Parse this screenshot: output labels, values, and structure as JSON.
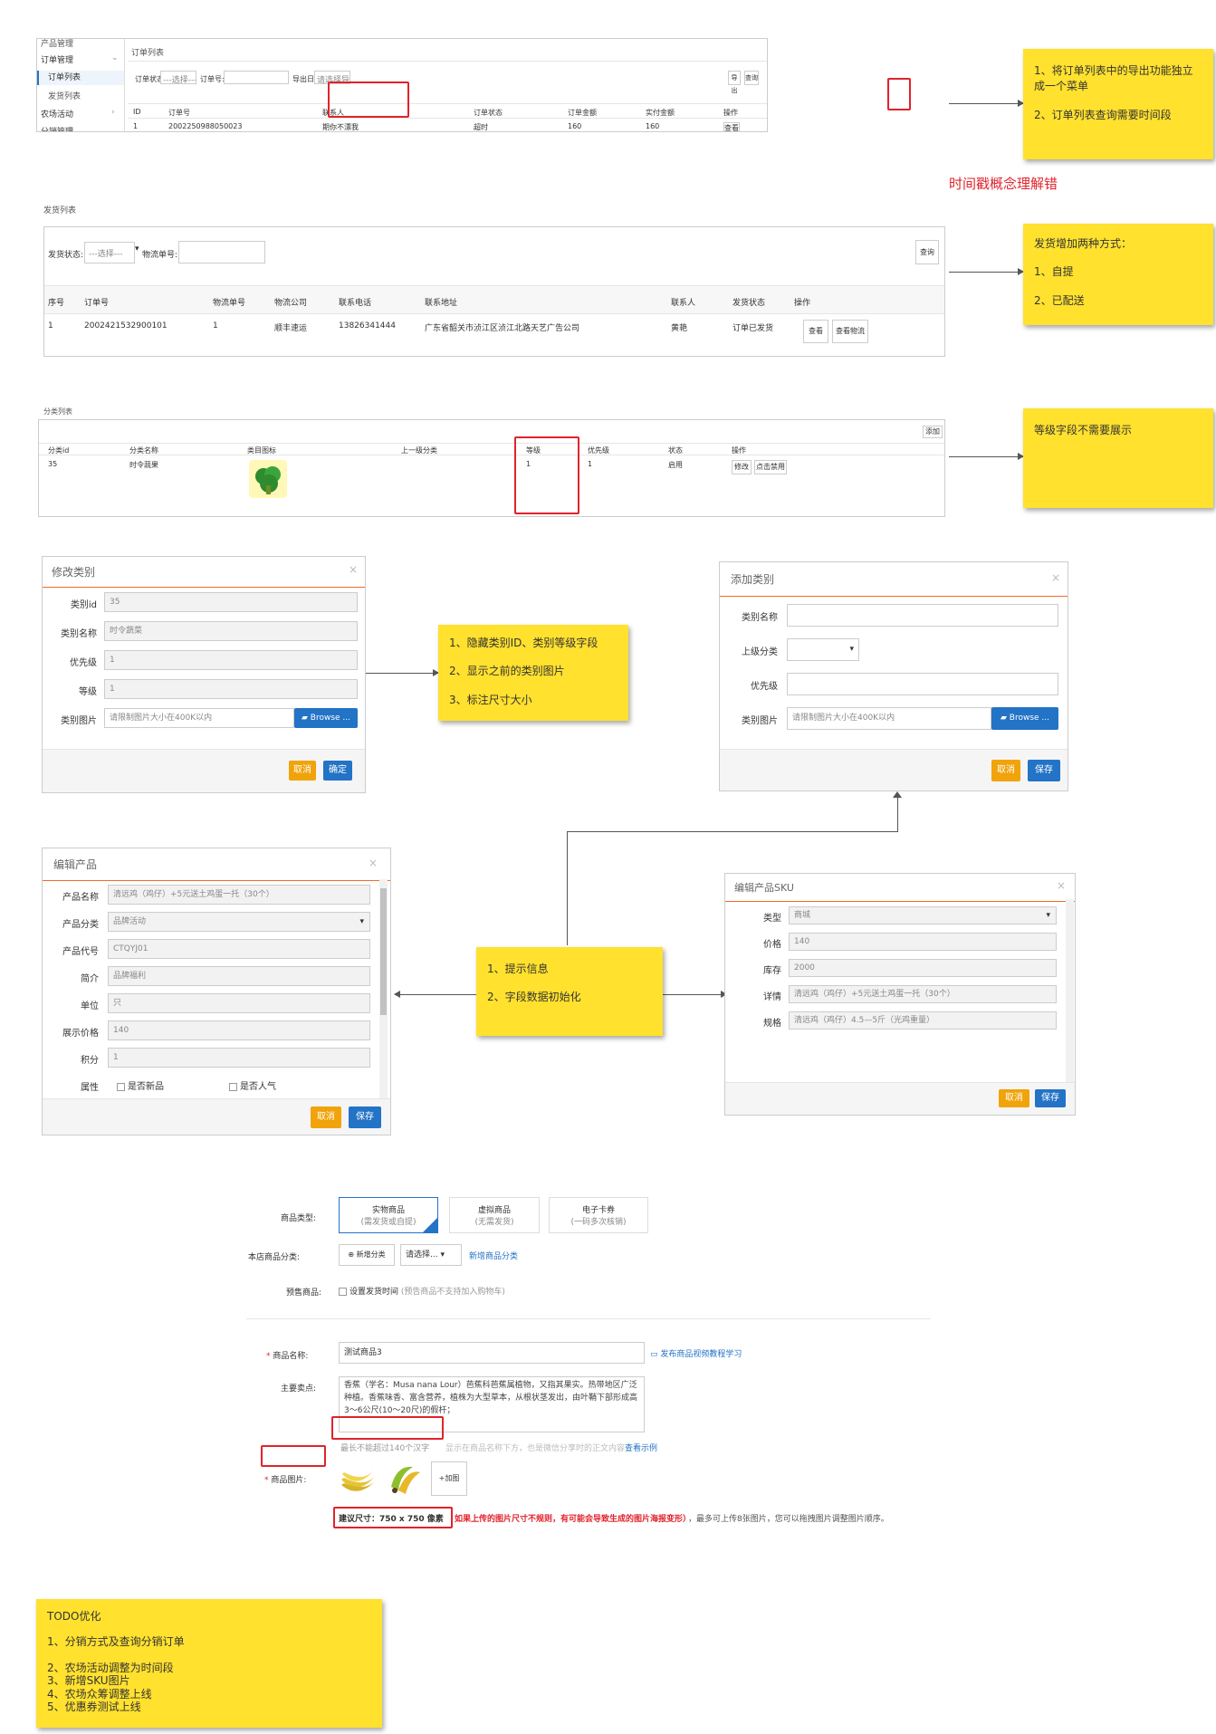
{
  "order_list": {
    "sidebar": [
      "产品管理",
      "订单管理",
      "订单列表",
      "发货列表",
      "农场活动",
      "分销管理"
    ],
    "title": "订单列表",
    "filter_status_label": "订单状态:",
    "filter_status_value": "---选择---",
    "filter_order_label": "订单号:",
    "filter_export_label": "导出日期:",
    "filter_export_value": "请选择导出日",
    "export_btn": "导出",
    "query_btn": "查询",
    "columns": [
      "ID",
      "订单号",
      "联系人",
      "订单状态",
      "订单金额",
      "实付金额",
      "操作"
    ],
    "row": [
      "1",
      "2002250988050023",
      "期你不漂我",
      "超时",
      "160",
      "160",
      "查看"
    ]
  },
  "note_order": {
    "line1": "1、将订单列表中的导出功能独立成一个菜单",
    "line2": "2、订单列表查询需要时间段"
  },
  "timestamp_note": "时间戳概念理解错",
  "ship_list": {
    "title": "发货列表",
    "filter_status_label": "发货状态:",
    "filter_status_value": "---选择---",
    "filter_logistics_label": "物流单号:",
    "query_btn": "查询",
    "columns": [
      "序号",
      "订单号",
      "物流单号",
      "物流公司",
      "联系电话",
      "联系地址",
      "联系人",
      "发货状态",
      "操作"
    ],
    "row": [
      "1",
      "2002421532900101",
      "1",
      "顺丰速运",
      "13826341444",
      "广东省韶关市浈江区浈江北路天艺广告公司",
      "黄艳",
      "订单已发货"
    ],
    "view_btn": "查看",
    "logistics_btn": "查看物流"
  },
  "note_ship": {
    "title": "发货增加两种方式：",
    "line1": "1、自提",
    "line2": "2、已配送"
  },
  "cat_list": {
    "title": "分类列表",
    "add_btn": "添加",
    "columns": [
      "分类id",
      "分类名称",
      "类目图标",
      "上一级分类",
      "等级",
      "优先级",
      "状态",
      "操作"
    ],
    "row": [
      "35",
      "时令蔬果",
      "",
      "",
      "1",
      "1",
      "启用"
    ],
    "edit_btn": "修改",
    "disable_btn": "点击禁用"
  },
  "note_cat": {
    "line1": "等级字段不需要展示"
  },
  "edit_cat": {
    "title": "修改类别",
    "labels": [
      "类别id",
      "类别名称",
      "优先级",
      "等级",
      "类别图片"
    ],
    "values": [
      "35",
      "时令蔬菜",
      "1",
      "1",
      "请限制图片大小在400K以内"
    ],
    "browse": "Browse ...",
    "cancel": "取消",
    "ok": "确定"
  },
  "note_edit_cat": {
    "line1": "1、隐藏类别ID、类别等级字段",
    "line2": "2、显示之前的类别图片",
    "line3": "3、标注尺寸大小"
  },
  "add_cat": {
    "title": "添加类别",
    "labels": [
      "类别名称",
      "上级分类",
      "优先级",
      "类别图片"
    ],
    "image_placeholder": "请限制图片大小在400K以内",
    "browse": "Browse ...",
    "cancel": "取消",
    "save": "保存"
  },
  "edit_product": {
    "title": "编辑产品",
    "labels": [
      "产品名称",
      "产品分类",
      "产品代号",
      "简介",
      "单位",
      "展示价格",
      "积分",
      "属性"
    ],
    "values": [
      "清远鸡（鸡仔）+5元送土鸡蛋一托（30个）",
      "品牌活动",
      "CTQYJ01",
      "品牌福利",
      "只",
      "140",
      "1"
    ],
    "attr_new": "是否新品",
    "attr_hot": "是否人气",
    "cancel": "取消",
    "save": "保存"
  },
  "note_product": {
    "line1": "1、提示信息",
    "line2": "2、字段数据初始化"
  },
  "edit_sku": {
    "title": "编辑产品SKU",
    "labels": [
      "类型",
      "价格",
      "库存",
      "详情",
      "规格"
    ],
    "values": [
      "商城",
      "140",
      "2000",
      "清远鸡（鸡仔）+5元送土鸡蛋一托（30个）",
      "清远鸡（鸡仔）4.5—5斤（光鸡重量）"
    ],
    "cancel": "取消",
    "save": "保存"
  },
  "publish": {
    "type_label": "商品类型:",
    "types": [
      {
        "name": "实物商品",
        "sub": "(需发货或自提)"
      },
      {
        "name": "虚拟商品",
        "sub": "(无需发货)"
      },
      {
        "name": "电子卡券",
        "sub": "(一码多次核销)"
      }
    ],
    "category_label": "本店商品分类:",
    "new_category_btn": "新增分类",
    "category_select": "请选择...",
    "new_category_link": "新增商品分类",
    "presale_label": "预售商品:",
    "presale_text": "设置发货时间",
    "presale_hint": "(预告商品不支持加入购物车)",
    "name_label": "商品名称:",
    "name_value": "测试商品3",
    "video_link": "发布商品视频教程学习",
    "selling_label": "主要卖点:",
    "selling_text": "香蕉（学名：Musa nana Lour）芭蕉科芭蕉属植物，又指其果实。热带地区广泛种植。香蕉味香、富含营养，植株为大型草本，从根状茎发出，由叶鞘下部形成高3～6公尺(10～20尺)的假杆；",
    "selling_limit": "最长不能超过140个汉字",
    "selling_hint": "显示在商品名称下方，也是微信分享时的正文内容",
    "example_link": "查看示例",
    "image_label": "商品图片:",
    "add_image": "+加图",
    "size_tip": "建议尺寸：750 x 750 像素",
    "size_warning": "如果上传的图片尺寸不规则，有可能会导致生成的图片海报变形）",
    "size_rest": "，最多可上传8张图片，您可以拖拽图片调整图片顺序。"
  },
  "todo": {
    "title": "TODO优化",
    "line1": "1、分销方式及查询分销订单",
    "line2": "2、农场活动调整为时间段",
    "line3": "3、新增SKU图片",
    "line4": "4、农场众筹调整上线",
    "line5": "5、优惠券测试上线"
  },
  "colors": {
    "sticky": "#ffe12e",
    "annotation": "#e0232c",
    "accent": "#f26a2a",
    "primary": "#2373c6",
    "cancel": "#f0a30a"
  }
}
